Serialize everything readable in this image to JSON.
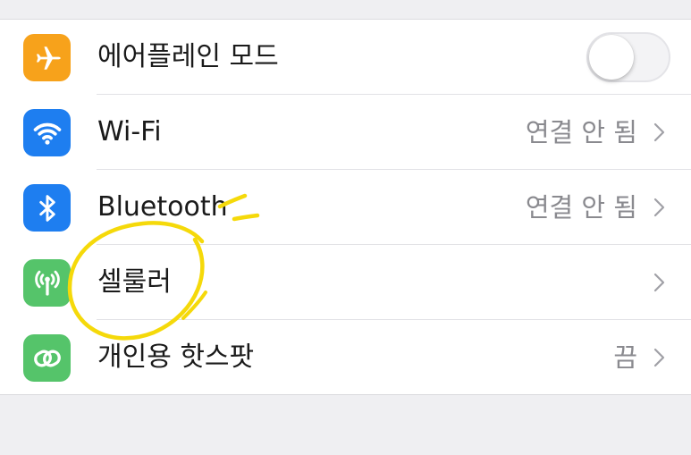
{
  "settings": {
    "rows": [
      {
        "label": "에어플레인 모드",
        "value": "",
        "icon": "airplane-icon",
        "icon_color": "#f7a21b",
        "control": "toggle",
        "toggle_on": false
      },
      {
        "label": "Wi-Fi",
        "value": "연결 안 됨",
        "icon": "wifi-icon",
        "icon_color": "#1e7ef0",
        "control": "chevron"
      },
      {
        "label": "Bluetooth",
        "value": "연결 안 됨",
        "icon": "bluetooth-icon",
        "icon_color": "#1e7ef0",
        "control": "chevron"
      },
      {
        "label": "셀룰러",
        "value": "",
        "icon": "cellular-antenna-icon",
        "icon_color": "#55c46a",
        "control": "chevron"
      },
      {
        "label": "개인용 핫스팟",
        "value": "끔",
        "icon": "hotspot-link-icon",
        "icon_color": "#55c46a",
        "control": "chevron"
      }
    ]
  },
  "annotation": {
    "kind": "yellow-hand-drawn-circle",
    "color": "#f5d90a",
    "target": "셀룰러"
  }
}
